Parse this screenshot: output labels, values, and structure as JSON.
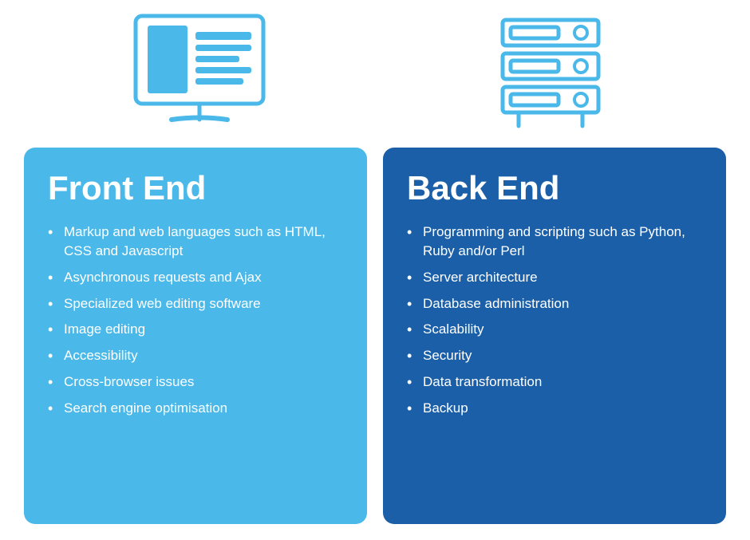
{
  "icons": {
    "monitor_label": "monitor-icon",
    "server_label": "server-icon"
  },
  "front_end": {
    "title": "Front End",
    "items": [
      "Markup and web languages such as HTML, CSS and Javascript",
      "Asynchronous requests and Ajax",
      "Specialized web editing software",
      "Image editing",
      "Accessibility",
      "Cross-browser issues",
      "Search engine optimisation"
    ]
  },
  "back_end": {
    "title": "Back End",
    "items": [
      "Programming and scripting such as Python, Ruby and/or Perl",
      "Server architecture",
      "Database administration",
      "Scalability",
      "Security",
      "Data transformation",
      "Backup"
    ]
  }
}
